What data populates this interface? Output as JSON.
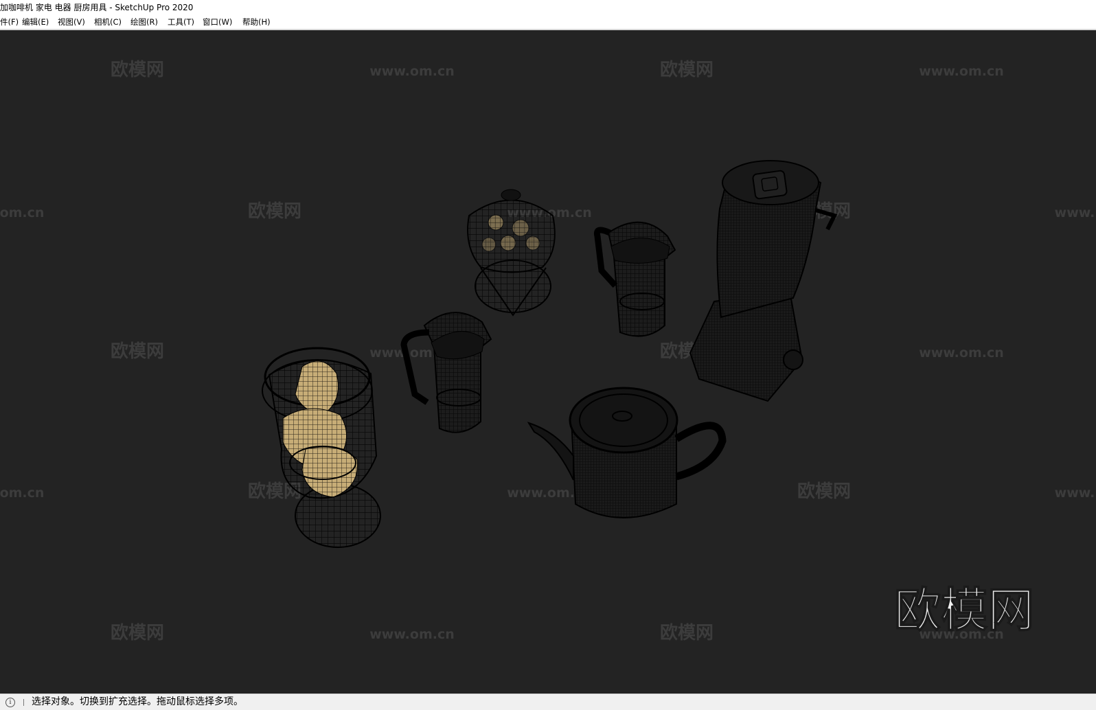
{
  "window": {
    "title": "加咖啡机 家电 电器 厨房用具 - SketchUp Pro 2020"
  },
  "menu": [
    {
      "label": "件(F)"
    },
    {
      "label": "编辑(E)"
    },
    {
      "label": "视图(V)"
    },
    {
      "label": "相机(C)"
    },
    {
      "label": "绘图(R)"
    },
    {
      "label": "工具(T)"
    },
    {
      "label": "窗口(W)"
    },
    {
      "label": "帮助(H)"
    }
  ],
  "watermark": {
    "brand": "欧模网",
    "url": "www.om.cn",
    "url_left_clip": "om.cn",
    "url_right_clip": "www."
  },
  "statusbar": {
    "icon": "info-icon",
    "text": "选择对象。切换到扩充选择。拖动鼠标选择多项。"
  },
  "colors": {
    "viewport_bg": "#232323",
    "wireframe": "#000000",
    "highlight_fill": "#c8b078",
    "watermark": "#3c3c3c"
  }
}
